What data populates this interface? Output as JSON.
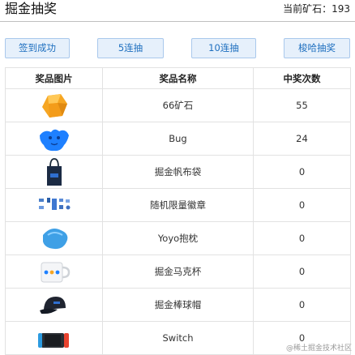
{
  "header": {
    "title": "掘金抽奖",
    "ore_label": "当前矿石：",
    "ore_value": "193"
  },
  "buttons": {
    "checkin": "签到成功",
    "five": "5连抽",
    "ten": "10连抽",
    "all": "梭哈抽奖"
  },
  "table": {
    "headers": [
      "奖品图片",
      "奖品名称",
      "中奖次数"
    ],
    "rows": [
      {
        "icon": "ore-gem-icon",
        "name": "66矿石",
        "count": "55"
      },
      {
        "icon": "bug-icon",
        "name": "Bug",
        "count": "24"
      },
      {
        "icon": "canvas-bag-icon",
        "name": "掘金帆布袋",
        "count": "0"
      },
      {
        "icon": "badge-set-icon",
        "name": "随机限量徽章",
        "count": "0"
      },
      {
        "icon": "pillow-icon",
        "name": "Yoyo抱枕",
        "count": "0"
      },
      {
        "icon": "mug-icon",
        "name": "掘金马克杯",
        "count": "0"
      },
      {
        "icon": "cap-icon",
        "name": "掘金棒球帽",
        "count": "0"
      },
      {
        "icon": "console-icon",
        "name": "Switch",
        "count": "0"
      }
    ]
  },
  "watermark": "@稀土掘金技术社区",
  "colors": {
    "button_bg": "#e6f0fb",
    "button_border": "#a9c8ec",
    "button_text": "#1e6fbf",
    "bug_blue": "#1e80ff",
    "ore_orange": "#f6a623"
  }
}
